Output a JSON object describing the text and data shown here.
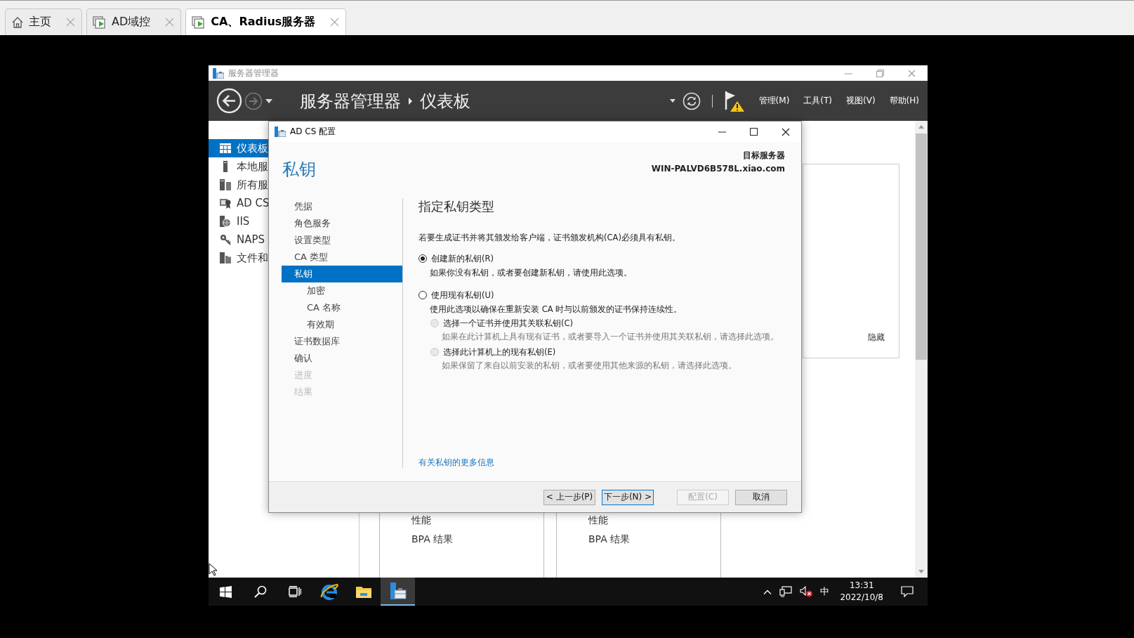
{
  "browser_tabs": [
    {
      "label": "主页",
      "kind": "home",
      "selected": false
    },
    {
      "label": "AD域控",
      "kind": "vm",
      "selected": false
    },
    {
      "label": "CA、Radius服务器",
      "kind": "vm",
      "selected": true
    }
  ],
  "server_manager": {
    "title": "服务器管理器",
    "breadcrumb": [
      "服务器管理器",
      "仪表板"
    ],
    "menus": [
      "管理(M)",
      "工具(T)",
      "视图(V)",
      "帮助(H)"
    ],
    "nav": [
      {
        "label": "仪表板",
        "kind": "dashboard",
        "selected": true
      },
      {
        "label": "本地服",
        "kind": "server",
        "selected": false
      },
      {
        "label": "所有服",
        "kind": "servers",
        "selected": false
      },
      {
        "label": "AD CS",
        "kind": "certificate",
        "selected": false
      },
      {
        "label": "IIS",
        "kind": "iis",
        "selected": false
      },
      {
        "label": "NAPS",
        "kind": "key",
        "selected": false
      },
      {
        "label": "文件和",
        "kind": "files",
        "selected": false
      }
    ],
    "hide_link": "隐藏",
    "tiles": [
      {
        "rows": [
          "性能",
          "BPA 结果"
        ]
      },
      {
        "rows": [
          "性能",
          "BPA 结果"
        ]
      }
    ]
  },
  "dialog": {
    "title": "AD CS 配置",
    "heading": "私钥",
    "target_label": "目标服务器",
    "target_server": "WIN-PALVD6B578L.xiao.com",
    "steps": [
      {
        "label": "凭据",
        "selected": false,
        "disabled": false
      },
      {
        "label": "角色服务",
        "selected": false,
        "disabled": false
      },
      {
        "label": "设置类型",
        "selected": false,
        "disabled": false
      },
      {
        "label": "CA 类型",
        "selected": false,
        "disabled": false
      },
      {
        "label": "私钥",
        "selected": true,
        "disabled": false,
        "children": [
          {
            "label": "加密",
            "selected": false,
            "disabled": false
          },
          {
            "label": "CA 名称",
            "selected": false,
            "disabled": false
          },
          {
            "label": "有效期",
            "selected": false,
            "disabled": false
          }
        ]
      },
      {
        "label": "证书数据库",
        "selected": false,
        "disabled": false
      },
      {
        "label": "确认",
        "selected": false,
        "disabled": false
      },
      {
        "label": "进度",
        "selected": false,
        "disabled": true
      },
      {
        "label": "结果",
        "selected": false,
        "disabled": true
      }
    ],
    "section_title": "指定私钥类型",
    "intro": "若要生成证书并将其颁发给客户端，证书颁发机构(CA)必须具有私钥。",
    "options": [
      {
        "label": "创建新的私钥(R)",
        "description": "如果你没有私钥，或者要创建新私钥，请使用此选项。",
        "selected": true,
        "disabled": false
      },
      {
        "label": "使用现有私钥(U)",
        "description": "使用此选项以确保在重新安装 CA 时与以前颁发的证书保持连续性。",
        "selected": false,
        "disabled": false,
        "children": [
          {
            "label": "选择一个证书并使用其关联私钥(C)",
            "description": "如果在此计算机上具有现有证书，或者要导入一个证书并使用其关联私钥，请选择此选项。",
            "selected": false,
            "disabled": true
          },
          {
            "label": "选择此计算机上的现有私钥(E)",
            "description": "如果保留了来自以前安装的私钥，或者要使用其他来源的私钥，请选择此选项。",
            "selected": false,
            "disabled": true
          }
        ]
      }
    ],
    "more_info_link": "有关私钥的更多信息",
    "buttons": [
      {
        "label": "< 上一步(P)",
        "disabled": false,
        "default": false
      },
      {
        "label": "下一步(N) >",
        "disabled": false,
        "default": true
      },
      {
        "label": "配置(C)",
        "disabled": true,
        "default": false
      },
      {
        "label": "取消",
        "disabled": false,
        "default": false
      }
    ]
  },
  "taskbar": {
    "apps": [
      {
        "kind": "start",
        "selected": false
      },
      {
        "kind": "search",
        "selected": false
      },
      {
        "kind": "taskview",
        "selected": false
      },
      {
        "kind": "browser",
        "selected": false
      },
      {
        "kind": "folder",
        "selected": false
      },
      {
        "kind": "servermanager",
        "selected": true
      }
    ],
    "ime": "中",
    "time": "13:31",
    "date": "2022/10/8"
  }
}
